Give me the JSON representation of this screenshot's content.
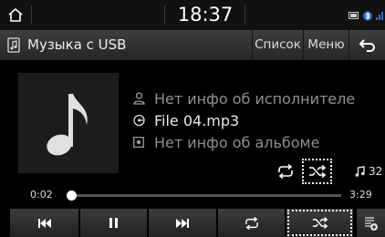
{
  "statusbar": {
    "clock": "18:37",
    "icons": [
      "home-icon",
      "battery-icon",
      "bluetooth-icon",
      "signal-icon"
    ]
  },
  "header": {
    "source_icon": "usb-music-icon",
    "title": "Музыка с USB",
    "list_label": "Список",
    "menu_label": "Меню",
    "back_icon": "back-arrow-icon"
  },
  "track": {
    "artist": "Нет инфо об исполнителе",
    "file": "File 04.mp3",
    "album": "Нет инфо об альбоме",
    "artist_icon": "person-icon",
    "file_icon": "file-icon",
    "album_icon": "album-icon",
    "art_icon": "music-note-icon"
  },
  "modes": {
    "repeat_icon": "repeat-icon",
    "shuffle_icon": "shuffle-icon",
    "track_count": "32"
  },
  "progress": {
    "elapsed": "0:02",
    "total": "3:29",
    "fraction": 0.01
  },
  "controls": {
    "prev_icon": "prev-track-icon",
    "pause_icon": "pause-icon",
    "next_icon": "next-track-icon",
    "repeat_icon": "repeat-icon",
    "shuffle_icon": "shuffle-icon",
    "playlist_icon": "playlist-icon"
  },
  "colors": {
    "accent": "#ffffff",
    "muted_text": "#8f8f8f",
    "background": "#000000"
  }
}
